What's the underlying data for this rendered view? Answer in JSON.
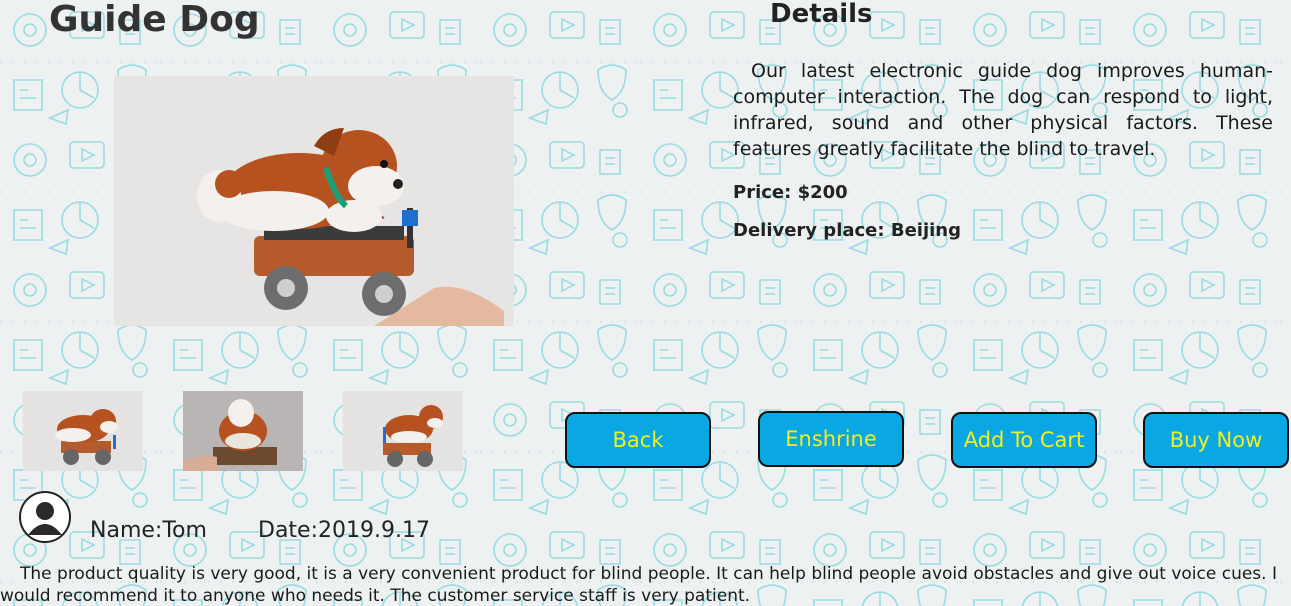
{
  "product": {
    "title": "Guide Dog",
    "details_heading": "Details",
    "description": "Our latest electronic guide dog improves human-computer interaction. The dog can respond to light, infrared, sound and other physical factors. These features greatly facilitate the blind to travel.",
    "price": "Price: $200",
    "delivery": "Delivery place: Beijing"
  },
  "buttons": {
    "back": "Back",
    "enshrine": "Enshrine",
    "add_to_cart": "Add To Cart",
    "buy_now": "Buy Now"
  },
  "review": {
    "name": "Name:Tom",
    "date": "Date:2019.9.17",
    "text": "The product quality is very good, it is a very convenient product for blind people. It can help blind people avoid obstacles and give out voice cues. I would recommend it to anyone who needs it. The customer service staff is very patient."
  },
  "colors": {
    "button_fill": "#09a8e5",
    "button_text": "#f2ee1f",
    "pattern": "#7fd6df",
    "background": "#eef1f1"
  }
}
